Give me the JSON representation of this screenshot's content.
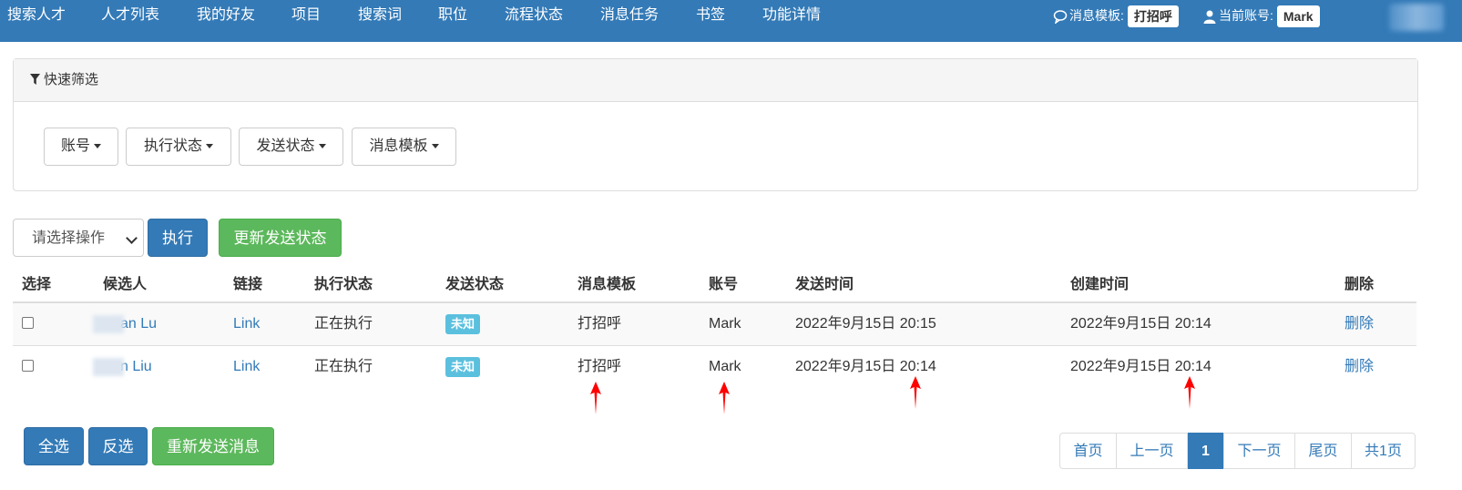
{
  "nav": {
    "items": [
      "搜索人才",
      "人才列表",
      "我的好友",
      "项目",
      "搜索词",
      "职位",
      "流程状态",
      "消息任务",
      "书签",
      "功能详情"
    ],
    "template_label": "消息模板:",
    "template_value": "打招呼",
    "account_label": "当前账号:",
    "account_value": "Mark"
  },
  "filter": {
    "title": "快速筛选",
    "dropdowns": [
      "账号",
      "执行状态",
      "发送状态",
      "消息模板"
    ]
  },
  "actions": {
    "select_placeholder": "请选择操作",
    "execute": "执行",
    "update_status": "更新发送状态"
  },
  "table": {
    "headers": [
      "选择",
      "候选人",
      "链接",
      "执行状态",
      "发送状态",
      "消息模板",
      "账号",
      "发送时间",
      "创建时间",
      "删除"
    ],
    "rows": [
      {
        "candidate": "an Lu",
        "link": "Link",
        "exec_status": "正在执行",
        "send_status": "未知",
        "template": "打招呼",
        "account": "Mark",
        "send_time": "2022年9月15日 20:15",
        "create_time": "2022年9月15日 20:14",
        "delete": "删除"
      },
      {
        "candidate": "n Liu",
        "link": "Link",
        "exec_status": "正在执行",
        "send_status": "未知",
        "template": "打招呼",
        "account": "Mark",
        "send_time": "2022年9月15日 20:14",
        "create_time": "2022年9月15日 20:14",
        "delete": "删除"
      }
    ]
  },
  "bottom": {
    "select_all": "全选",
    "invert": "反选",
    "resend": "重新发送消息"
  },
  "pagination": {
    "first": "首页",
    "prev": "上一页",
    "current": "1",
    "next": "下一页",
    "last": "尾页",
    "total": "共1页"
  },
  "colors": {
    "primary": "#337ab7",
    "success": "#5cb85c",
    "info": "#5bc0de",
    "annotation_arrow": "#ff0000"
  }
}
